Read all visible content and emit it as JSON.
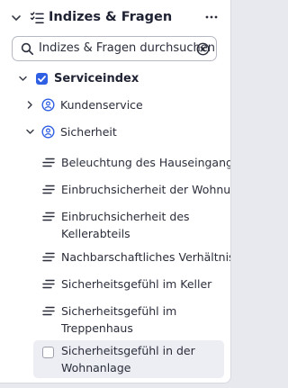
{
  "header": {
    "title": "Indizes & Fragen",
    "more_label": "···"
  },
  "search": {
    "placeholder": "Indizes & Fragen durchsuchen"
  },
  "tree": {
    "root": {
      "label": "Serviceindex",
      "checked": true
    },
    "groups": [
      {
        "label": "Kundenservice",
        "expanded": false
      },
      {
        "label": "Sicherheit",
        "expanded": true
      }
    ],
    "questions": [
      {
        "lines": [
          "Beleuchtung des Hauseingangs"
        ]
      },
      {
        "lines": [
          "Einbruchsicherheit der Wohnung"
        ]
      },
      {
        "lines": [
          "Einbruchsicherheit des",
          "Kellerabteils"
        ]
      },
      {
        "lines": [
          "Nachbarschaftliches Verhältnis"
        ]
      },
      {
        "lines": [
          "Sicherheitsgefühl im Keller"
        ]
      },
      {
        "lines": [
          "Sicherheitsgefühl im",
          "Treppenhaus"
        ]
      },
      {
        "lines": [
          "Sicherheitsgefühl in der",
          "Wohnanlage"
        ],
        "hovered": true
      }
    ]
  },
  "colors": {
    "accent": "#2f5fe3",
    "text": "#1f2233",
    "hover_bg": "#eceef3"
  }
}
